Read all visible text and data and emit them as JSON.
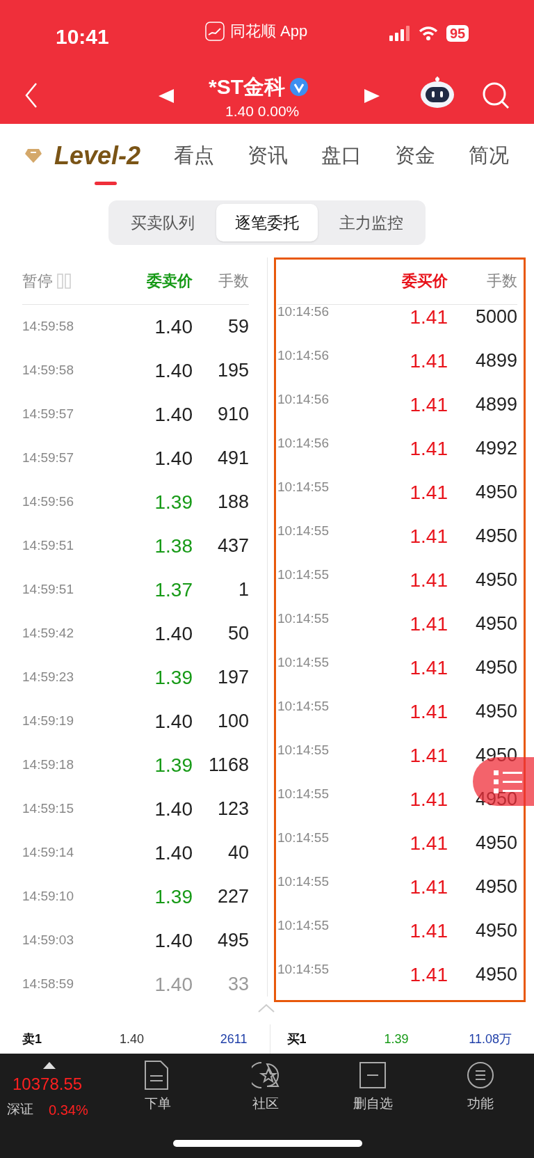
{
  "status_bar": {
    "time": "10:41",
    "app_name": "同花顺 App",
    "battery": "95"
  },
  "nav": {
    "title": "*ST金科",
    "quote": "1.40 0.00%"
  },
  "tabs": [
    {
      "label": "Level-2",
      "kind": "brand",
      "selected": true
    },
    {
      "label": "看点",
      "kind": "text",
      "selected": false
    },
    {
      "label": "资讯",
      "kind": "text",
      "selected": false
    },
    {
      "label": "盘口",
      "kind": "text",
      "selected": false
    },
    {
      "label": "资金",
      "kind": "text",
      "selected": false
    },
    {
      "label": "简况",
      "kind": "text",
      "selected": false
    }
  ],
  "segments": [
    {
      "label": "买卖队列",
      "selected": false
    },
    {
      "label": "逐笔委托",
      "selected": true
    },
    {
      "label": "主力监控",
      "selected": false
    }
  ],
  "sell_table": {
    "pause_label": "暂停",
    "price_header": "委卖价",
    "volume_header": "手数",
    "rows": [
      {
        "time": "14:59:58",
        "price": "1.40",
        "volume": "59",
        "color": "#222222"
      },
      {
        "time": "14:59:58",
        "price": "1.40",
        "volume": "195",
        "color": "#222222"
      },
      {
        "time": "14:59:57",
        "price": "1.40",
        "volume": "910",
        "color": "#222222"
      },
      {
        "time": "14:59:57",
        "price": "1.40",
        "volume": "491",
        "color": "#222222"
      },
      {
        "time": "14:59:56",
        "price": "1.39",
        "volume": "188",
        "color": "#179a17"
      },
      {
        "time": "14:59:51",
        "price": "1.38",
        "volume": "437",
        "color": "#179a17"
      },
      {
        "time": "14:59:51",
        "price": "1.37",
        "volume": "1",
        "color": "#179a17"
      },
      {
        "time": "14:59:42",
        "price": "1.40",
        "volume": "50",
        "color": "#222222"
      },
      {
        "time": "14:59:23",
        "price": "1.39",
        "volume": "197",
        "color": "#179a17"
      },
      {
        "time": "14:59:19",
        "price": "1.40",
        "volume": "100",
        "color": "#222222"
      },
      {
        "time": "14:59:18",
        "price": "1.39",
        "volume": "1168",
        "color": "#179a17"
      },
      {
        "time": "14:59:15",
        "price": "1.40",
        "volume": "123",
        "color": "#222222"
      },
      {
        "time": "14:59:14",
        "price": "1.40",
        "volume": "40",
        "color": "#222222"
      },
      {
        "time": "14:59:10",
        "price": "1.39",
        "volume": "227",
        "color": "#179a17"
      },
      {
        "time": "14:59:03",
        "price": "1.40",
        "volume": "495",
        "color": "#222222"
      },
      {
        "time": "14:58:59",
        "price": "1.40",
        "volume": "33",
        "color": "#9a9a9a"
      }
    ]
  },
  "buy_table": {
    "price_header": "委买价",
    "volume_header": "手数",
    "rows": [
      {
        "time": "10:14:56",
        "price": "1.41",
        "volume": "5000",
        "color": "#e8141c"
      },
      {
        "time": "10:14:56",
        "price": "1.41",
        "volume": "4899",
        "color": "#e8141c"
      },
      {
        "time": "10:14:56",
        "price": "1.41",
        "volume": "4899",
        "color": "#e8141c"
      },
      {
        "time": "10:14:56",
        "price": "1.41",
        "volume": "4992",
        "color": "#e8141c"
      },
      {
        "time": "10:14:55",
        "price": "1.41",
        "volume": "4950",
        "color": "#e8141c"
      },
      {
        "time": "10:14:55",
        "price": "1.41",
        "volume": "4950",
        "color": "#e8141c"
      },
      {
        "time": "10:14:55",
        "price": "1.41",
        "volume": "4950",
        "color": "#e8141c"
      },
      {
        "time": "10:14:55",
        "price": "1.41",
        "volume": "4950",
        "color": "#e8141c"
      },
      {
        "time": "10:14:55",
        "price": "1.41",
        "volume": "4950",
        "color": "#e8141c"
      },
      {
        "time": "10:14:55",
        "price": "1.41",
        "volume": "4950",
        "color": "#e8141c"
      },
      {
        "time": "10:14:55",
        "price": "1.41",
        "volume": "4950",
        "color": "#e8141c"
      },
      {
        "time": "10:14:55",
        "price": "1.41",
        "volume": "4950",
        "color": "#e8141c"
      },
      {
        "time": "10:14:55",
        "price": "1.41",
        "volume": "4950",
        "color": "#e8141c"
      },
      {
        "time": "10:14:55",
        "price": "1.41",
        "volume": "4950",
        "color": "#e8141c"
      },
      {
        "time": "10:14:55",
        "price": "1.41",
        "volume": "4950",
        "color": "#e8141c"
      },
      {
        "time": "10:14:55",
        "price": "1.41",
        "volume": "4950",
        "color": "#e8141c"
      }
    ]
  },
  "best_quotes": [
    {
      "label": "卖1",
      "price": "1.40",
      "volume": "2611",
      "color": "#333333"
    },
    {
      "label": "买1",
      "price": "1.39",
      "volume": "11.08万",
      "color": "#179a17"
    }
  ],
  "index": {
    "value": "10378.55",
    "name": "深证",
    "change": "0.34%"
  },
  "bottom_nav": [
    {
      "label": "下单",
      "kind": "document"
    },
    {
      "label": "社区",
      "kind": "community"
    },
    {
      "label": "删自选",
      "kind": "remove"
    },
    {
      "label": "功能",
      "kind": "menu"
    }
  ]
}
